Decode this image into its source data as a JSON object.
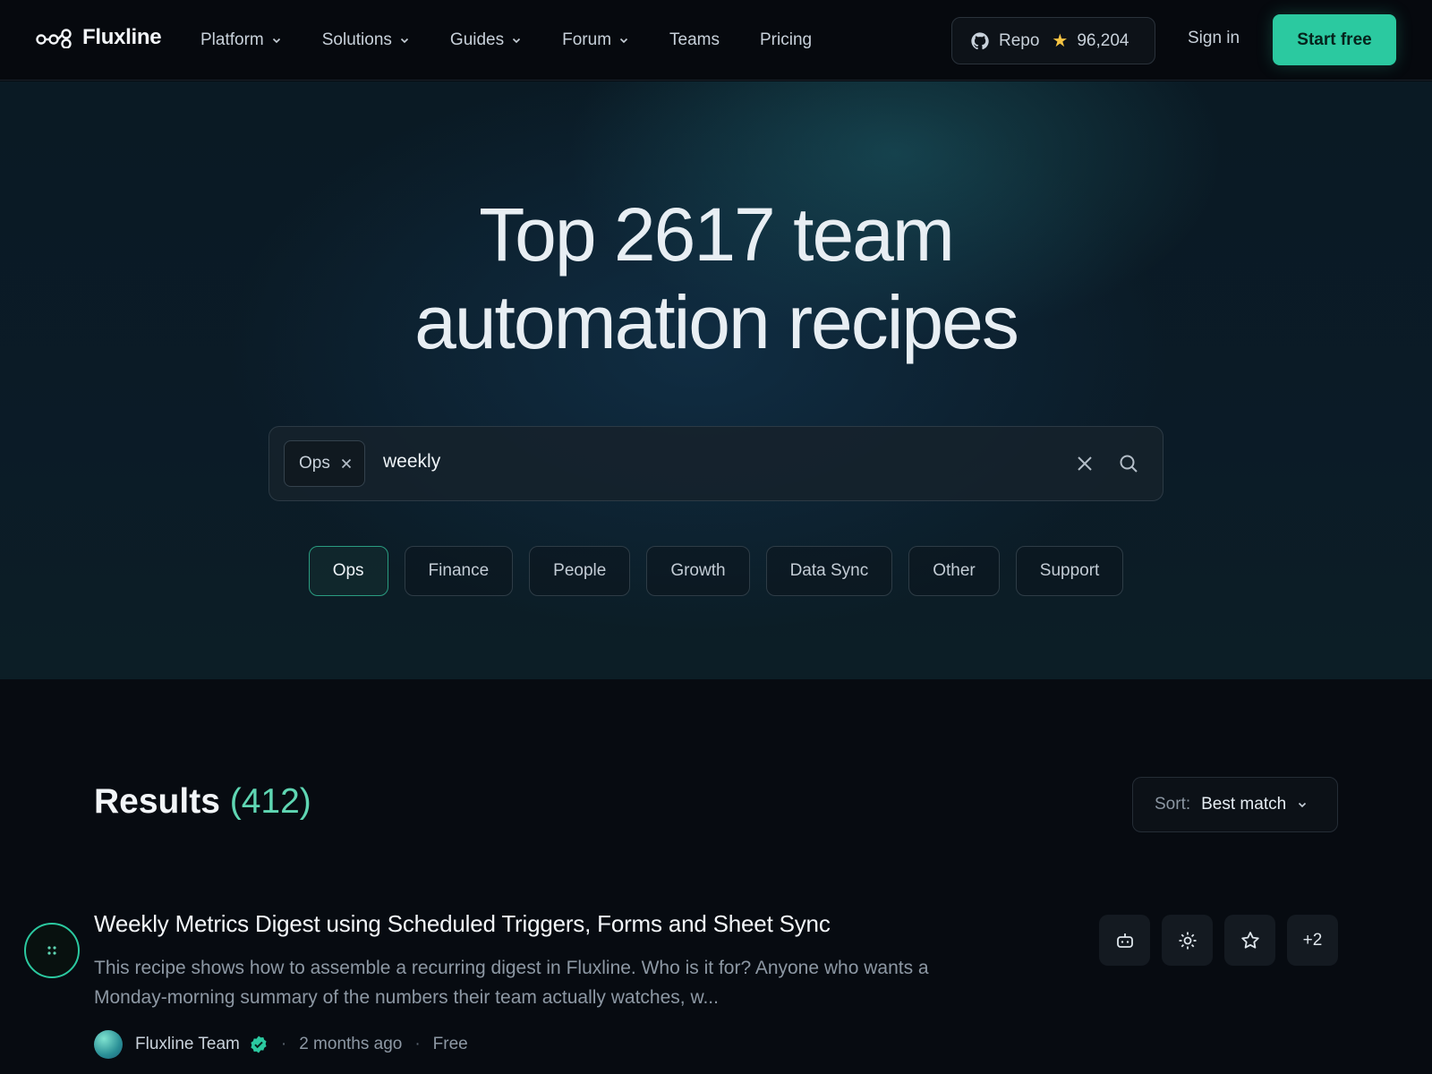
{
  "nav": {
    "brand": "Fluxline",
    "menu": [
      {
        "label": "Platform",
        "has_dropdown": true
      },
      {
        "label": "Solutions",
        "has_dropdown": true
      },
      {
        "label": "Guides",
        "has_dropdown": true
      },
      {
        "label": "Forum",
        "has_dropdown": true
      },
      {
        "label": "Teams",
        "has_dropdown": false
      },
      {
        "label": "Pricing",
        "has_dropdown": false
      }
    ],
    "repo_label": "Repo",
    "repo_stars": "96,204",
    "signin": "Sign in",
    "cta": "Start free"
  },
  "hero": {
    "title_line1": "Top 2617 team",
    "title_line2": "automation recipes",
    "search": {
      "chip_label": "Ops",
      "query": "weekly"
    },
    "filters": [
      "Ops",
      "Finance",
      "People",
      "Growth",
      "Data Sync",
      "Other",
      "Support"
    ],
    "active_filter": "Ops"
  },
  "results": {
    "label": "Results",
    "count": "(412)",
    "sort_label": "Sort:",
    "sort_value": "Best match",
    "items": [
      {
        "title": "Weekly Metrics Digest using Scheduled Triggers, Forms and Sheet Sync",
        "description": "This recipe shows how to assemble a recurring digest in Fluxline. Who is it for? Anyone who wants a Monday-morning summary of the numbers their team actually watches, w...",
        "author": "Fluxline Team",
        "time": "2 months ago",
        "price": "Free",
        "extra_count": "+2"
      }
    ]
  },
  "colors": {
    "accent": "#2bc9a0",
    "background": "#070b11",
    "star": "#f5c443"
  }
}
